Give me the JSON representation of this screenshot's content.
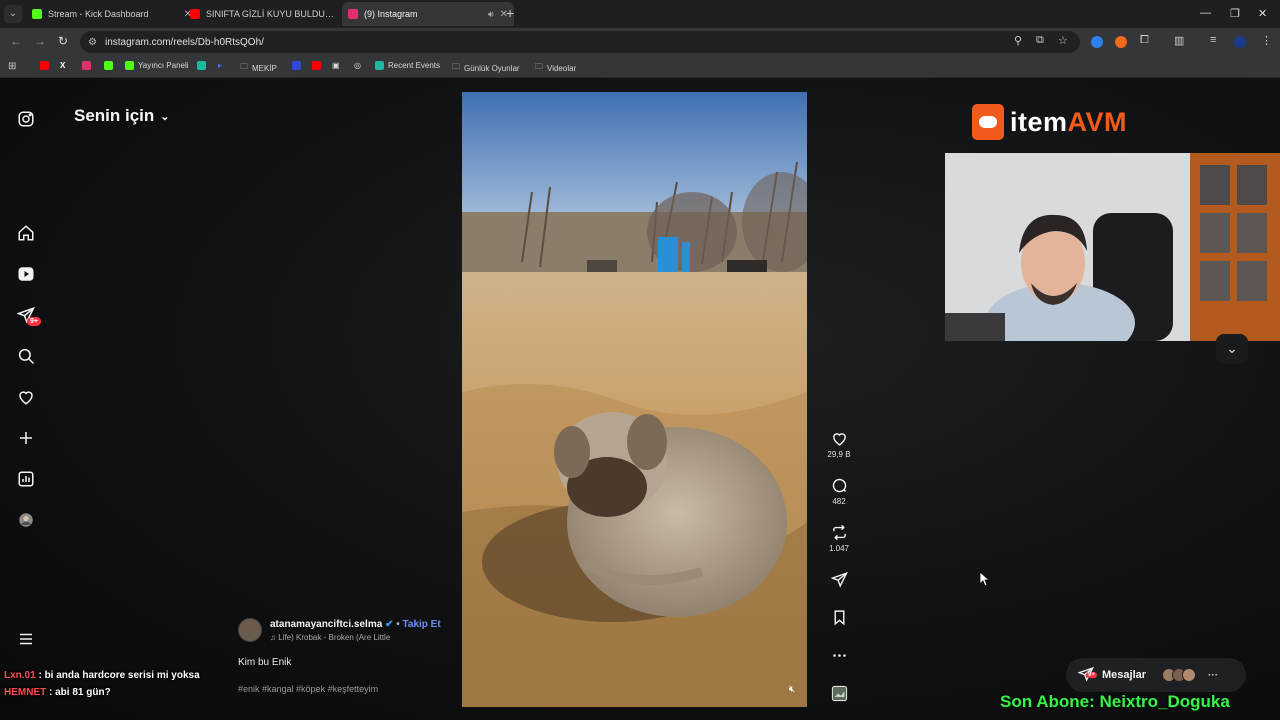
{
  "browser": {
    "tabs": [
      {
        "title": "Stream - Kick Dashboard",
        "favicon_color": "#53fc18",
        "active": false
      },
      {
        "title": "SINIFTA GİZLİ KUYU BULDUK! 🤔",
        "favicon_color": "#ff0000",
        "active": false
      },
      {
        "title": "(9) Instagram",
        "favicon_color": "#e1306c",
        "active": true
      }
    ],
    "url": "instagram.com/reels/Db-h0RtsQOh/",
    "bookmarks": [
      {
        "label": "",
        "color": "#ff0000",
        "icon": "youtube-icon"
      },
      {
        "label": "",
        "color": "#ffffff",
        "icon": "x-icon"
      },
      {
        "label": "",
        "color": "#e1306c",
        "icon": "instagram-icon"
      },
      {
        "label": "",
        "color": "#53fc18",
        "icon": "kick-icon"
      },
      {
        "label": "Yayıncı Paneli",
        "color": "#53fc18",
        "icon": "kick-icon"
      },
      {
        "label": "",
        "color": "#1fb7a1",
        "icon": "app-icon"
      },
      {
        "label": "",
        "color": "#4a6cf7",
        "icon": "play-icon"
      },
      {
        "label": "MEKİP",
        "color": "#bbbbbb",
        "icon": "folder-icon"
      },
      {
        "label": "",
        "color": "#2f4ad8",
        "icon": "app-icon"
      },
      {
        "label": "",
        "color": "#ff0000",
        "icon": "youtube-icon"
      },
      {
        "label": "",
        "color": "#dddddd",
        "icon": "image-icon"
      },
      {
        "label": "",
        "color": "#dddddd",
        "icon": "globe-icon"
      },
      {
        "label": "Recent Events",
        "color": "#1fb7a1",
        "icon": "app-icon"
      },
      {
        "label": "Günlük Oyunlar",
        "color": "#bbbbbb",
        "icon": "folder-icon"
      },
      {
        "label": "Videolar",
        "color": "#bbbbbb",
        "icon": "folder-icon"
      }
    ]
  },
  "instagram": {
    "feed_title": "Senin için",
    "notification_badge": "9+",
    "post": {
      "username": "atanamayanciftci.selma",
      "follow_label": "Takip Et",
      "music": "Life) Krobak - Broken (Are Little",
      "caption": "Kim bu Enik",
      "hashtags": "#enik #kangal #köpek #keşfetteyim"
    },
    "actions": {
      "likes": "29,9 B",
      "comments": "482",
      "reposts": "1.047"
    },
    "messages_label": "Mesajlar",
    "messages_badge": "9+"
  },
  "overlay": {
    "logo_text_a": "item",
    "logo_text_b": "AVM",
    "chat": [
      {
        "nick": "Lxn.01",
        "message": " : bi anda hardcore serisi mi yoksa"
      },
      {
        "nick": "HEMNET",
        "message": " : abi 81 gün?"
      }
    ],
    "subscriber_ticker": "Son Abone: Neixtro_Doguka"
  }
}
